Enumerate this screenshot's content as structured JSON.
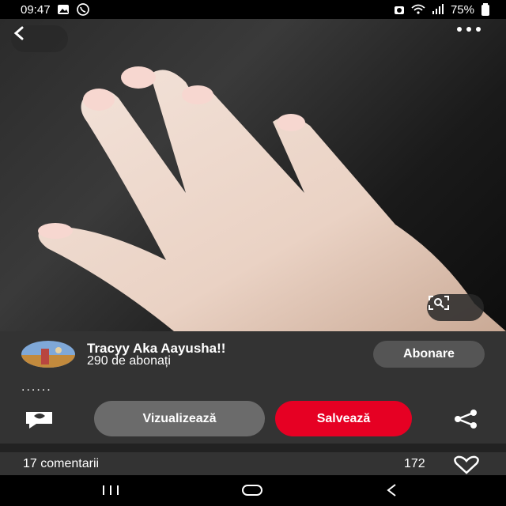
{
  "status": {
    "time": "09:47",
    "battery": "75%",
    "colors": {
      "bar_bg": "#000000",
      "text": "#ffffff"
    },
    "icons": [
      "image-icon",
      "whatsapp-icon",
      "alarm-icon",
      "wifi-icon",
      "signal-icon",
      "battery-icon"
    ]
  },
  "hero": {
    "description": "Hand photo on dark background",
    "actions": {
      "back": "back-icon",
      "more": "more-icon",
      "lens": "visual-search-icon"
    }
  },
  "pin": {
    "author": {
      "name": "Tracyy Aka Aayusha!!",
      "followers": "290 de abonați",
      "follow_label": "Abonare"
    },
    "description": "......",
    "actions": {
      "view_label": "Vizualizează",
      "save_label": "Salvează"
    },
    "comments_label": "17 comentarii",
    "likes": "172",
    "colors": {
      "panel_bg": "#333333",
      "save_bg": "#e60023",
      "view_bg": "#6b6b6b",
      "follow_bg": "#555555"
    }
  },
  "nav": {
    "icons": [
      "recents-icon",
      "home-icon",
      "back-icon"
    ]
  }
}
